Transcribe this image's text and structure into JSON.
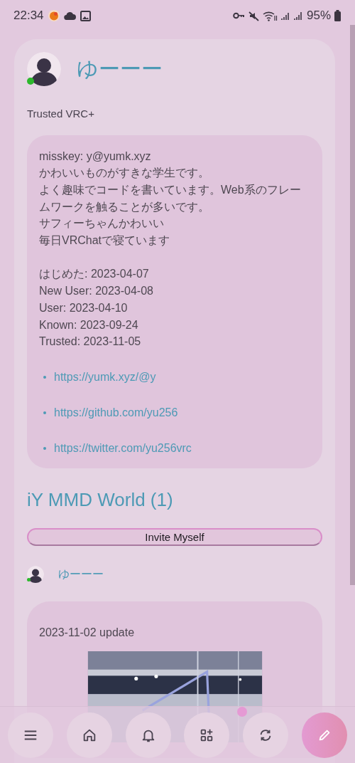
{
  "status_bar": {
    "time": "22:34",
    "battery": "95%"
  },
  "profile": {
    "name": "ゆーーー",
    "online": true,
    "rank": "Trusted VRC+"
  },
  "bio": {
    "lines": [
      "misskey: y@yumk.xyz",
      "かわいいものがすきな学生です。",
      "よく趣味でコードを書いています。Web系のフレームワークを触ることが多いです。",
      "サフィーちゃんかわいい",
      "毎日VRChatで寝ています"
    ],
    "dates": [
      "はじめた: 2023-04-07",
      "New User: 2023-04-08",
      "User: 2023-04-10",
      "Known: 2023-09-24",
      "Trusted: 2023-11-05"
    ],
    "links": [
      "https://yumk.xyz/@y",
      "https://github.com/yu256",
      "https://twitter.com/yu256vrc"
    ]
  },
  "world": {
    "title": "iY MMD World (1)",
    "invite_button": "Invite Myself",
    "author": {
      "name": "ゆーーー",
      "online": true
    },
    "description": "2023-11-02 update"
  },
  "nav": [
    {
      "kind": "menu",
      "badge": false
    },
    {
      "kind": "home",
      "badge": false
    },
    {
      "kind": "bell",
      "badge": false
    },
    {
      "kind": "apps",
      "badge": false
    },
    {
      "kind": "refresh",
      "badge": true
    },
    {
      "kind": "edit",
      "badge": false
    }
  ]
}
